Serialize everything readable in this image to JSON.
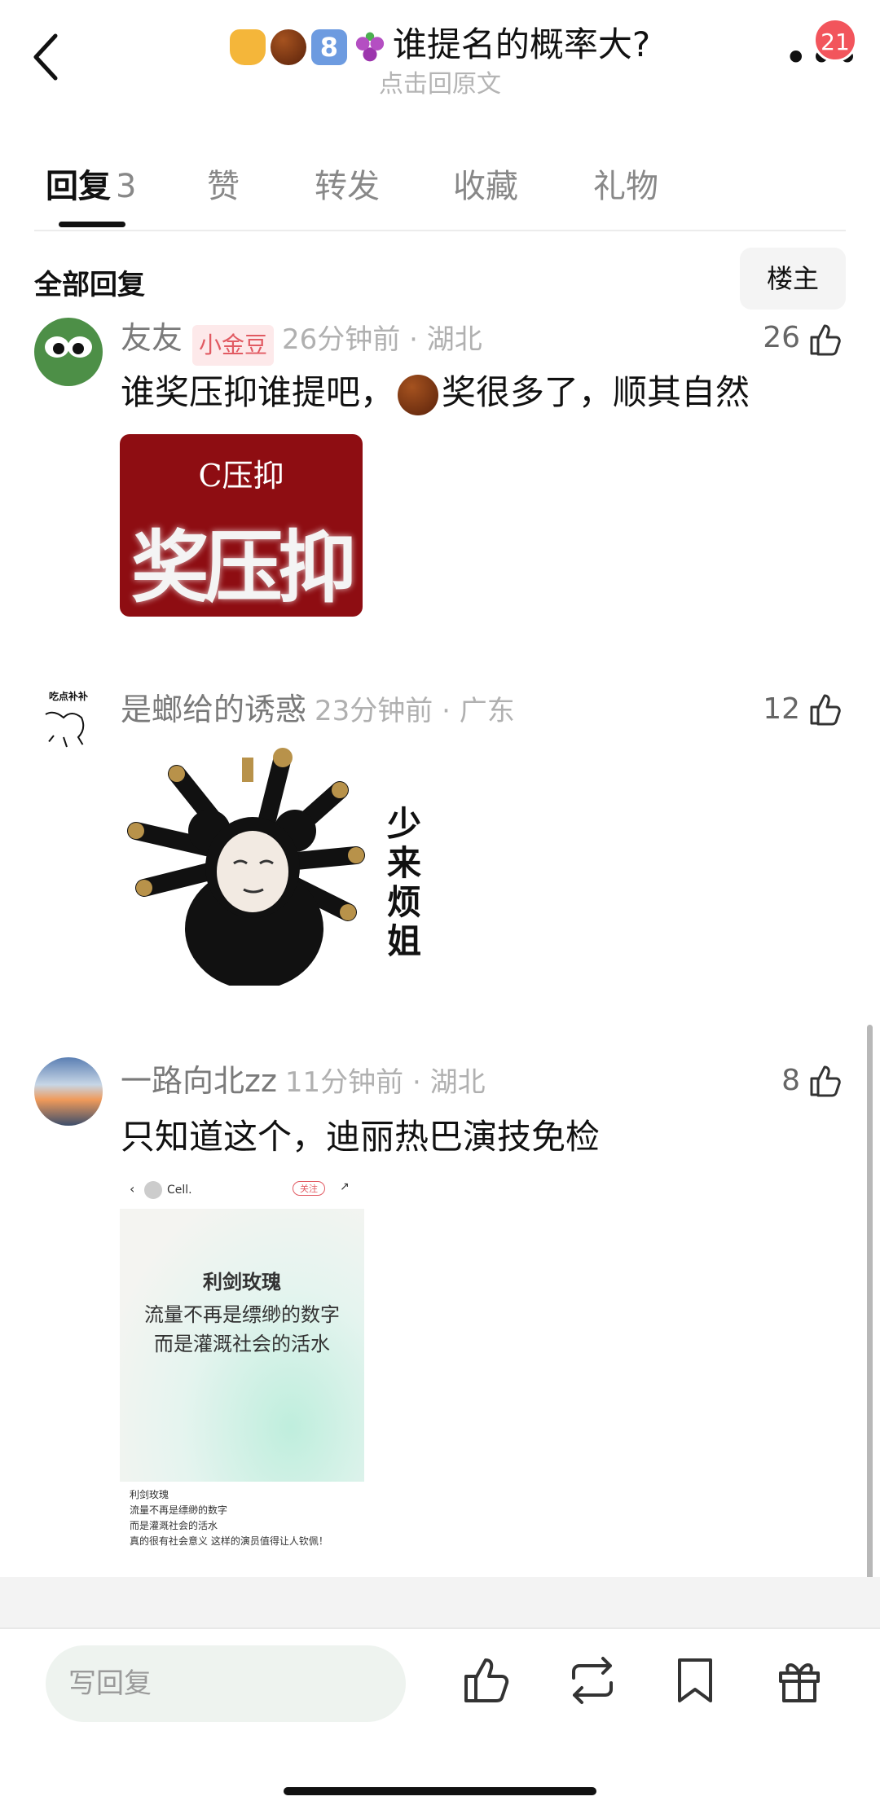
{
  "header": {
    "title_text": "谁提名的概率大?",
    "title_emojis": [
      "honey-pot-icon",
      "chestnut-icon",
      "keycap-8-icon",
      "grapes-icon"
    ],
    "keycap_label": "8",
    "subtitle": "点击回原文",
    "notification_count": "21"
  },
  "tabs": [
    {
      "label": "回复",
      "count": "3",
      "active": true
    },
    {
      "label": "赞"
    },
    {
      "label": "转发"
    },
    {
      "label": "收藏"
    },
    {
      "label": "礼物"
    }
  ],
  "section": {
    "all_replies": "全部回复",
    "owner_filter": "楼主"
  },
  "comments": [
    {
      "name": "友友",
      "tag": "小金豆",
      "meta": "26分钟前 · 湖北",
      "likes": "26",
      "text_before": "谁奖压抑谁提吧，",
      "text_after": "奖很多了，顺其自然",
      "image": {
        "small": "C压抑",
        "big": "奖压抑"
      }
    },
    {
      "name": "是螂给的诱惑",
      "meta": "23分钟前 · 广东",
      "likes": "12",
      "avatar_text": "吃点补补",
      "image": {
        "caption": "少来烦姐"
      }
    },
    {
      "name": "一路向北zz",
      "meta": "11分钟前 · 湖北",
      "likes": "8",
      "text": "只知道这个，迪丽热巴演技免检",
      "image": {
        "account": "Cell.",
        "follow": "关注",
        "heading": "利剑玫瑰",
        "line1": "流量不再是缥缈的数字",
        "line2": "而是灌溉社会的活水",
        "body": [
          "利剑玫瑰",
          "流量不再是缥缈的数字",
          "而是灌溉社会的活水",
          "真的很有社会意义 这样的演员值得让人钦佩！"
        ]
      }
    }
  ],
  "bottom_bar": {
    "placeholder": "写回复",
    "icons": [
      "like-icon",
      "repost-icon",
      "bookmark-icon",
      "gift-icon"
    ]
  }
}
